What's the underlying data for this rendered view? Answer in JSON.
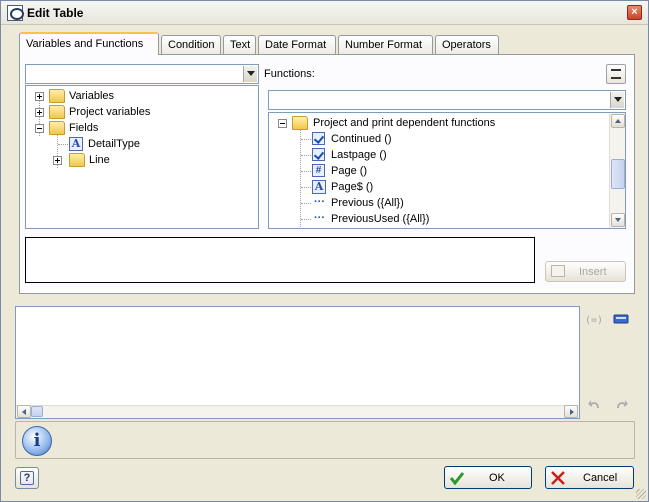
{
  "window": {
    "title": "Edit Table",
    "close_symbol": "×"
  },
  "tabs": [
    {
      "label": "Variables and Functions",
      "active": true
    },
    {
      "label": "Condition"
    },
    {
      "label": "Text"
    },
    {
      "label": "Date Format"
    },
    {
      "label": "Number Format"
    },
    {
      "label": "Operators"
    }
  ],
  "left_combo": {
    "value": ""
  },
  "variables_tree": [
    {
      "label": "Variables",
      "icon": "variables-folder-icon",
      "expander": "plus"
    },
    {
      "label": "Project variables",
      "icon": "project-variables-folder-icon",
      "expander": "plus"
    },
    {
      "label": "Fields",
      "icon": "fields-folder-icon",
      "expander": "minus"
    },
    {
      "label": "DetailType",
      "icon": "text-field-icon"
    },
    {
      "label": "Line",
      "icon": "folder-icon",
      "expander": "plus"
    }
  ],
  "functions": {
    "label": "Functions:",
    "combo_value": "",
    "tree": [
      {
        "label": "Project and print dependent functions",
        "icon": "folder-icon",
        "expander": "minus"
      },
      {
        "label": "Continued ()",
        "icon": "boolean-icon"
      },
      {
        "label": "Lastpage ()",
        "icon": "boolean-icon"
      },
      {
        "label": "Page ()",
        "icon": "number-icon"
      },
      {
        "label": "Page$ ()",
        "icon": "text-icon"
      },
      {
        "label": "Previous ({All})",
        "icon": "any-type-icon"
      },
      {
        "label": "PreviousUsed ({All})",
        "icon": "any-type-icon"
      }
    ]
  },
  "insert_button": {
    "label": "Insert",
    "enabled": false
  },
  "buttons": {
    "ok": "OK",
    "cancel": "Cancel"
  },
  "colors": {
    "accent_tab": "#f6c34b",
    "ok_check": "#2a9a2a",
    "cancel_x": "#c8201a"
  }
}
